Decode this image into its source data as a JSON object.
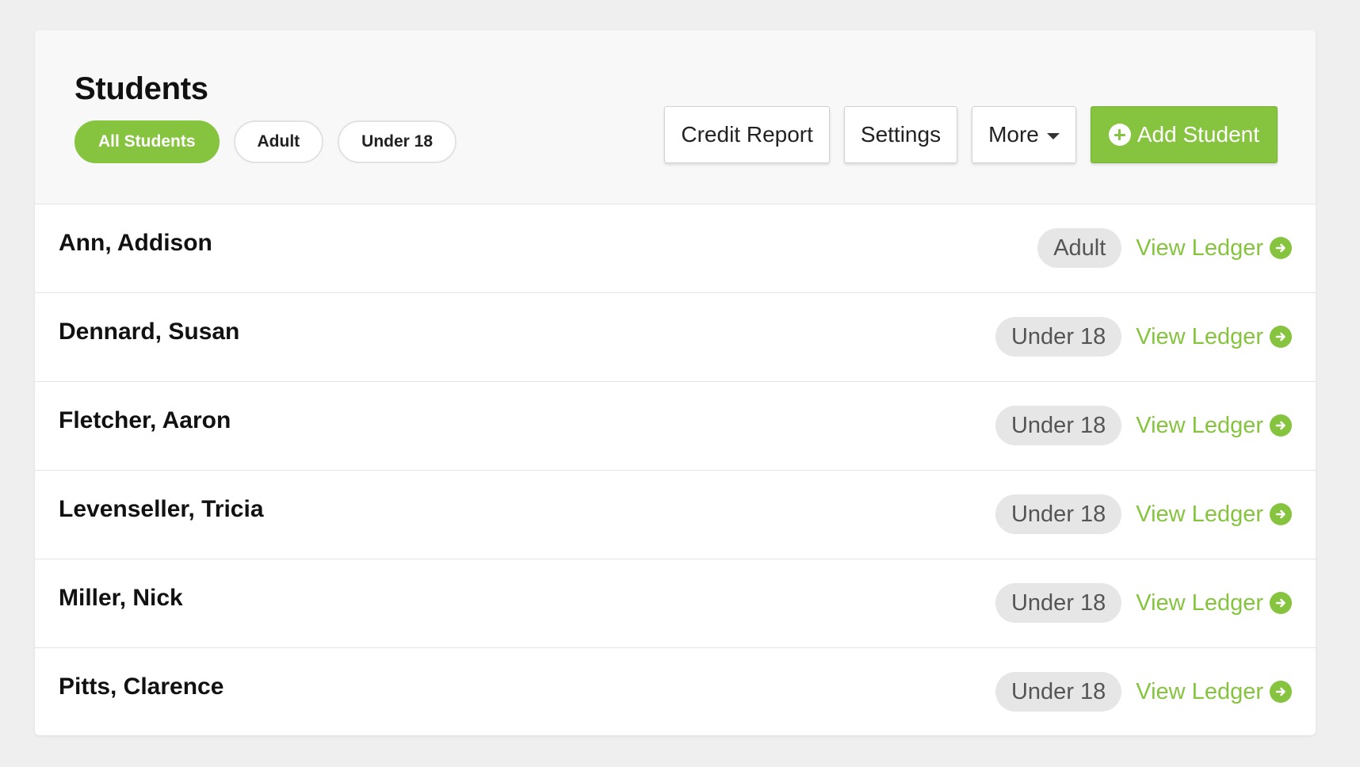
{
  "header": {
    "title": "Students",
    "filters": [
      {
        "label": "All Students",
        "active": true
      },
      {
        "label": "Adult",
        "active": false
      },
      {
        "label": "Under 18",
        "active": false
      }
    ],
    "actions": {
      "credit_report": "Credit Report",
      "settings": "Settings",
      "more": "More",
      "add_student": "Add Student"
    }
  },
  "students": [
    {
      "name": "Ann, Addison",
      "badge": "Adult",
      "link": "View Ledger"
    },
    {
      "name": "Dennard, Susan",
      "badge": "Under 18",
      "link": "View Ledger"
    },
    {
      "name": "Fletcher, Aaron",
      "badge": "Under 18",
      "link": "View Ledger"
    },
    {
      "name": "Levenseller, Tricia",
      "badge": "Under 18",
      "link": "View Ledger"
    },
    {
      "name": "Miller, Nick",
      "badge": "Under 18",
      "link": "View Ledger"
    },
    {
      "name": "Pitts, Clarence",
      "badge": "Under 18",
      "link": "View Ledger"
    }
  ],
  "icons": {
    "add": "plus-circle-icon",
    "dropdown": "caret-down-icon",
    "ledger": "arrow-right-circle-icon"
  },
  "colors": {
    "accent": "#86c440",
    "badge_bg": "#e6e6e6",
    "page_bg": "#efefef"
  }
}
